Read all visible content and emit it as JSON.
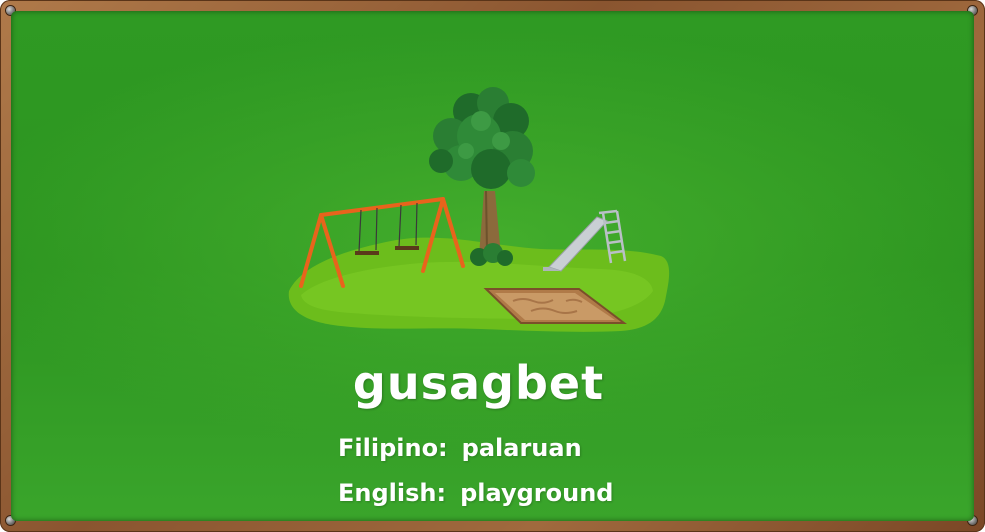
{
  "card": {
    "word": "gusagbet",
    "filipino_label": "Filipino:",
    "filipino_value": "palaruan",
    "english_label": "English:",
    "english_value": "playground"
  },
  "illustration": {
    "subject": "playground-scene",
    "elements": [
      "tree",
      "swing-set",
      "slide",
      "sandbox",
      "grass-patch"
    ]
  },
  "colors": {
    "board_green": "#2f9a23",
    "frame_brown": "#8a5530",
    "text": "#ffffff",
    "swing_frame": "#e8641c",
    "grass": "#7cc21f"
  }
}
